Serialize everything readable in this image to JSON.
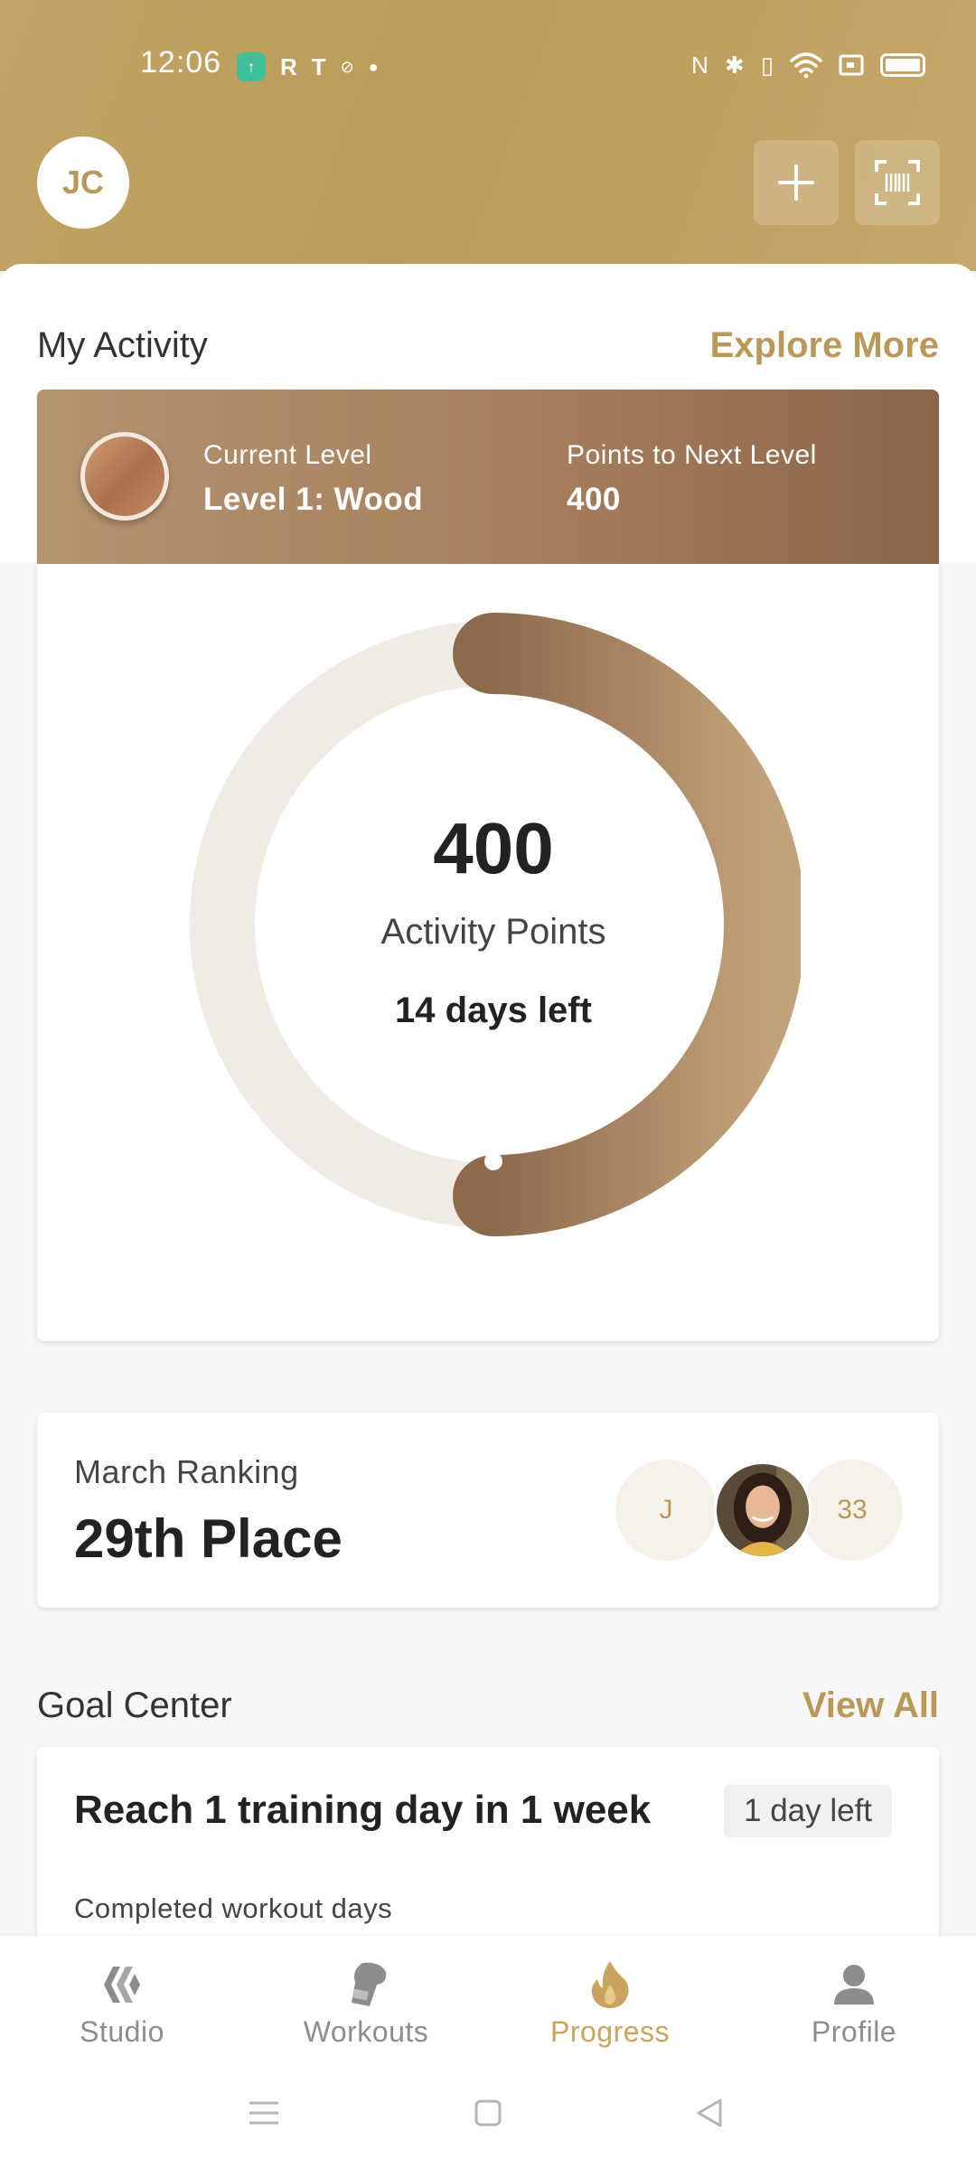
{
  "status_bar": {
    "time": "12:06",
    "left_icons": [
      "app-notification-icon",
      "r-icon",
      "t-icon",
      "sync-icon",
      "dot-icon"
    ],
    "right_icons": [
      "nfc-icon",
      "bluetooth-icon",
      "vibrate-icon",
      "wifi-icon",
      "cast-icon",
      "battery-icon"
    ]
  },
  "header": {
    "avatar_initials": "JC",
    "add_icon": "plus-icon",
    "scan_icon": "barcode-scan-icon"
  },
  "my_activity": {
    "title": "My Activity",
    "link": "Explore More",
    "current_level_label": "Current Level",
    "current_level_value": "Level 1: Wood",
    "next_level_label": "Points to Next Level",
    "next_level_value": "400",
    "points": "400",
    "points_label": "Activity Points",
    "days_left": "14 days left",
    "progress_fraction": 0.5
  },
  "ranking": {
    "label": "March Ranking",
    "value": "29th Place",
    "left_initial": "J",
    "right_number": "33"
  },
  "goal_center": {
    "title": "Goal Center",
    "link": "View All",
    "goal_title": "Reach 1 training day in 1 week",
    "badge": "1 day left",
    "subtitle": "Completed workout days"
  },
  "bottom_nav": {
    "items": [
      {
        "label": "Studio",
        "icon": "studio-icon"
      },
      {
        "label": "Workouts",
        "icon": "workouts-icon"
      },
      {
        "label": "Progress",
        "icon": "flame-icon"
      },
      {
        "label": "Profile",
        "icon": "profile-icon"
      }
    ],
    "active": "Progress"
  },
  "colors": {
    "accent": "#b8995a",
    "active_nav": "#c9a45e",
    "ring_track": "#f1ebe6",
    "ring_fill_start": "#8e6a4d",
    "ring_fill_end": "#c2a27a"
  }
}
